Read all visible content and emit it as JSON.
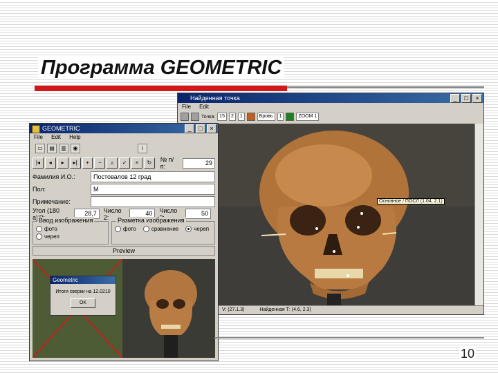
{
  "slide": {
    "title": "Программа GEOMETRIC",
    "page_number": "10"
  },
  "window_large": {
    "title": "Найденная точка",
    "menu": [
      "File",
      "Edit"
    ],
    "toolbar_values": [
      "Точка:",
      "15",
      "2",
      "1",
      "Бровь",
      "1",
      "ZOOM 1"
    ],
    "point_tooltip": "Основное / ПОСЛ (1.04,  2.1)",
    "status_left": "V: (27.1.3)",
    "status_right": "Найденная Т: (4.6, 2.3)"
  },
  "window_small": {
    "title": "GEOMETRIC",
    "menu": [
      "File",
      "Edit",
      "Help"
    ],
    "nav_label": "№ п/п:",
    "nav_value": "29",
    "fields": [
      {
        "label": "Фамилия И.О.:",
        "value": "Постовалов 12 град"
      },
      {
        "label": "Пол:",
        "value": "М"
      },
      {
        "label": "Примечание:",
        "value": ""
      }
    ],
    "angle_label": "Угол (180 а)/2:",
    "angle_value": "28,7",
    "n2_label": "Число 2:",
    "n2_value": "40",
    "n3_label": "Число 3:",
    "n3_value": "50",
    "group1_title": "Ввод изображения",
    "group1_opts": [
      "фото",
      "череп"
    ],
    "group2_title": "Разметка изображения",
    "group2_opts": [
      "фото",
      "череп",
      "сравнение"
    ],
    "preview_label": "Preview"
  },
  "dialog": {
    "title": "Geometric",
    "message": "Итоги сверки на 12.0210",
    "ok_label": "OK"
  }
}
